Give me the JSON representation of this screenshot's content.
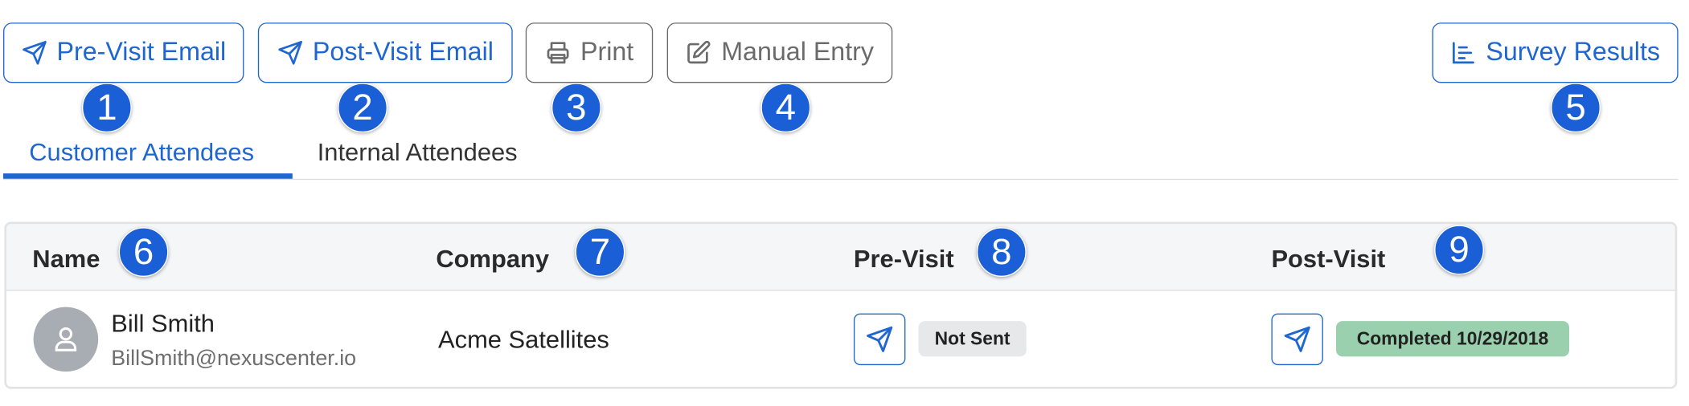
{
  "toolbar": {
    "pre_visit_email": {
      "label": "Pre-Visit Email",
      "icon": "paper-plane-icon"
    },
    "post_visit_email": {
      "label": "Post-Visit Email",
      "icon": "paper-plane-icon"
    },
    "print": {
      "label": "Print",
      "icon": "printer-icon"
    },
    "manual_entry": {
      "label": "Manual Entry",
      "icon": "edit-icon"
    },
    "survey_results": {
      "label": "Survey Results",
      "icon": "bar-chart-icon"
    }
  },
  "markers": [
    "1",
    "2",
    "3",
    "4",
    "5",
    "6",
    "7",
    "8",
    "9"
  ],
  "tabs": [
    {
      "label": "Customer Attendees",
      "active": true
    },
    {
      "label": "Internal Attendees",
      "active": false
    }
  ],
  "table": {
    "columns": [
      "Name",
      "Company",
      "Pre-Visit",
      "Post-Visit"
    ],
    "rows": [
      {
        "name": "Bill Smith",
        "email": "BillSmith@nexuscenter.io",
        "company": "Acme Satellites",
        "pre_visit_status": "Not Sent",
        "post_visit_status": "Completed 10/29/2018"
      }
    ]
  },
  "colors": {
    "accent": "#1f66d1",
    "marker": "#1a5fd6",
    "secondary_border": "#6b6b6b",
    "badge_neutral": "#e7e8ea",
    "badge_success": "#9ad0ad",
    "avatar": "#a7adb3"
  }
}
